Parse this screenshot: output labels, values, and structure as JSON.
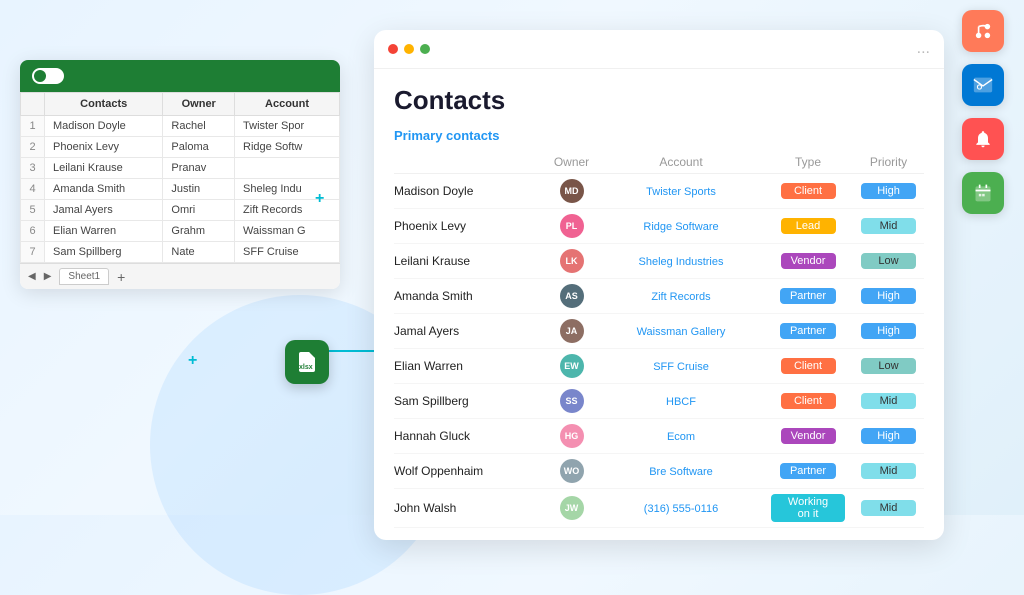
{
  "panel": {
    "title": "Contacts",
    "section_label": "Primary contacts",
    "dots": [
      "#f44336",
      "#ffb300",
      "#4caf50"
    ]
  },
  "spreadsheet": {
    "toggle": true,
    "columns": [
      "Contacts",
      "Owner",
      "Account"
    ],
    "rows": [
      {
        "num": "1",
        "contact": "Madison Doyle",
        "owner": "Rachel",
        "account": "Twister Spor"
      },
      {
        "num": "2",
        "contact": "Phoenix Levy",
        "owner": "Paloma",
        "account": "Ridge Softw"
      },
      {
        "num": "3",
        "contact": "Leilani Krause",
        "owner": "Pranav",
        "account": ""
      },
      {
        "num": "4",
        "contact": "Amanda Smith",
        "owner": "Justin",
        "account": "Sheleg Indu"
      },
      {
        "num": "5",
        "contact": "Jamal Ayers",
        "owner": "Omri",
        "account": "Zift Records"
      },
      {
        "num": "6",
        "contact": "Elian Warren",
        "owner": "Grahm",
        "account": "Waissman G"
      },
      {
        "num": "7",
        "contact": "Sam Spillberg",
        "owner": "Nate",
        "account": "SFF Cruise"
      }
    ],
    "sheet_tab": "Sheet1"
  },
  "contacts": [
    {
      "name": "Madison Doyle",
      "owner_color": "#795548",
      "account": "Twister Sports",
      "type": "Client",
      "type_class": "badge-client",
      "priority": "High",
      "priority_class": "badge-high"
    },
    {
      "name": "Phoenix Levy",
      "owner_color": "#f06292",
      "account": "Ridge Software",
      "type": "Lead",
      "type_class": "badge-lead",
      "priority": "Mid",
      "priority_class": "badge-mid"
    },
    {
      "name": "Leilani Krause",
      "owner_color": "#e57373",
      "account": "Sheleg Industries",
      "type": "Vendor",
      "type_class": "badge-vendor",
      "priority": "Low",
      "priority_class": "badge-low"
    },
    {
      "name": "Amanda Smith",
      "owner_color": "#546e7a",
      "account": "Zift Records",
      "type": "Partner",
      "type_class": "badge-partner",
      "priority": "High",
      "priority_class": "badge-high"
    },
    {
      "name": "Jamal Ayers",
      "owner_color": "#8d6e63",
      "account": "Waissman Gallery",
      "type": "Partner",
      "type_class": "badge-partner",
      "priority": "High",
      "priority_class": "badge-high"
    },
    {
      "name": "Elian Warren",
      "owner_color": "#4db6ac",
      "account": "SFF Cruise",
      "type": "Client",
      "type_class": "badge-client",
      "priority": "Low",
      "priority_class": "badge-low"
    },
    {
      "name": "Sam Spillberg",
      "owner_color": "#7986cb",
      "account": "HBCF",
      "type": "Client",
      "type_class": "badge-client",
      "priority": "Mid",
      "priority_class": "badge-mid"
    },
    {
      "name": "Hannah Gluck",
      "owner_color": "#f48fb1",
      "account": "Ecom",
      "type": "Vendor",
      "type_class": "badge-vendor",
      "priority": "High",
      "priority_class": "badge-high"
    },
    {
      "name": "Wolf Oppenhaim",
      "owner_color": "#90a4ae",
      "account": "Bre Software",
      "type": "Partner",
      "type_class": "badge-partner",
      "priority": "Mid",
      "priority_class": "badge-mid"
    },
    {
      "name": "John Walsh",
      "owner_color": "#a5d6a7",
      "account": "(316) 555-0116",
      "type": "Working on it",
      "type_class": "badge-working",
      "priority": "Mid",
      "priority_class": "badge-mid"
    }
  ],
  "table_headers": {
    "name": "",
    "owner": "Owner",
    "account": "Account",
    "type": "Type",
    "priority": "Priority"
  },
  "right_icons": [
    {
      "name": "hubspot-icon",
      "label": "H",
      "class": "hubspot-icon"
    },
    {
      "name": "outlook-icon",
      "label": "O",
      "class": "outlook-icon"
    },
    {
      "name": "bell-icon",
      "label": "🔔",
      "class": "bell-icon-wrap"
    },
    {
      "name": "calendar-icon",
      "label": "📅",
      "class": "calendar-icon"
    }
  ],
  "connector_icon": "X",
  "decorative": {
    "plus1": "+",
    "plus2": "+",
    "more_btn": "..."
  }
}
